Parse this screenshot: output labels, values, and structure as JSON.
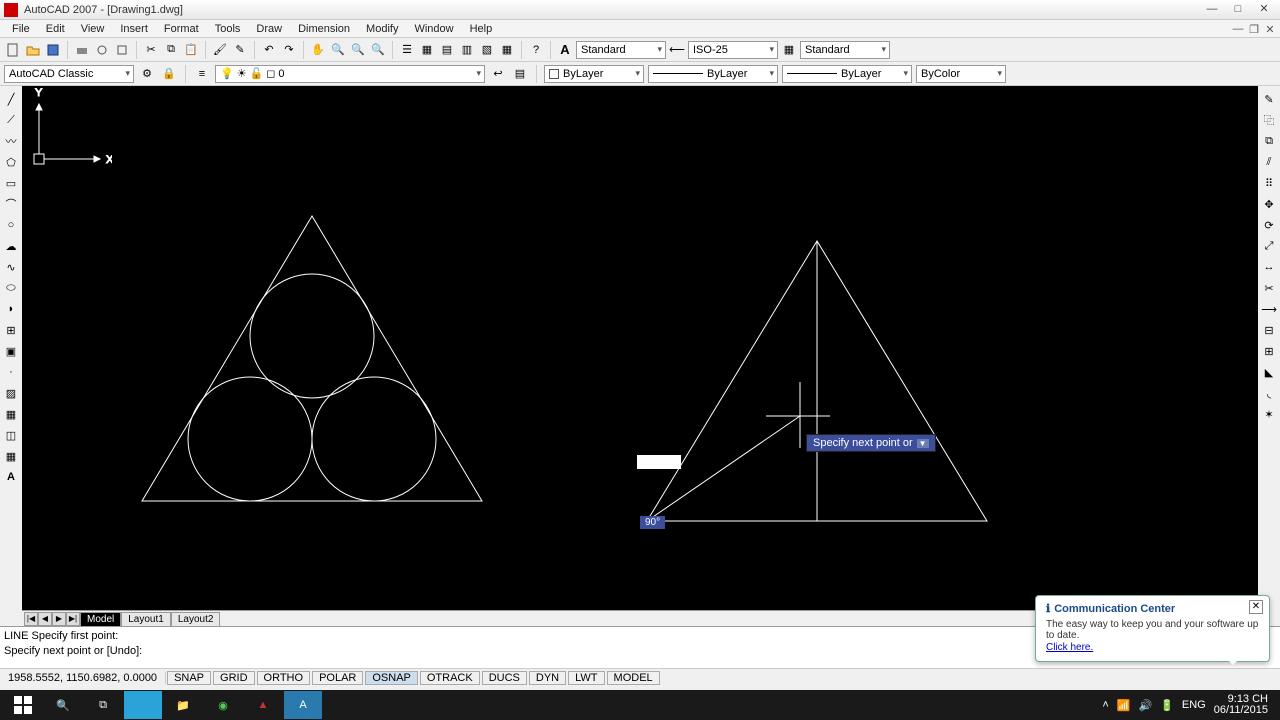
{
  "title": "AutoCAD 2007 - [Drawing1.dwg]",
  "menus": [
    "File",
    "Edit",
    "View",
    "Insert",
    "Format",
    "Tools",
    "Draw",
    "Dimension",
    "Modify",
    "Window",
    "Help"
  ],
  "workspace": "AutoCAD Classic",
  "style_dropdowns": {
    "text_style": "Standard",
    "dim_style": "ISO-25",
    "table_style": "Standard"
  },
  "layer": {
    "name": "0",
    "color_prop": "ByLayer",
    "linetype": "ByLayer",
    "lineweight": "ByLayer",
    "plot_style": "ByColor"
  },
  "tabs": {
    "nav": [
      "|◀",
      "◀",
      "▶",
      "▶|"
    ],
    "items": [
      "Model",
      "Layout1",
      "Layout2"
    ],
    "active": "Model"
  },
  "command_history": [
    "LINE Specify first point:",
    "Specify next point or [Undo]:"
  ],
  "status_coords": "1958.5552, 1150.6982, 0.0000",
  "status_toggles": [
    "SNAP",
    "GRID",
    "ORTHO",
    "POLAR",
    "OSNAP",
    "OTRACK",
    "DUCS",
    "DYN",
    "LWT",
    "MODEL"
  ],
  "status_active": [
    "OSNAP"
  ],
  "dyn_tooltip": "Specify next point or",
  "dyn_angle": "90°",
  "comm_center": {
    "title": "Communication Center",
    "body": "The easy way to keep you and your software up to date.",
    "link": "Click here."
  },
  "system_tray": {
    "lang": "ENG",
    "time": "9:13 CH",
    "date": "06/11/2015"
  }
}
